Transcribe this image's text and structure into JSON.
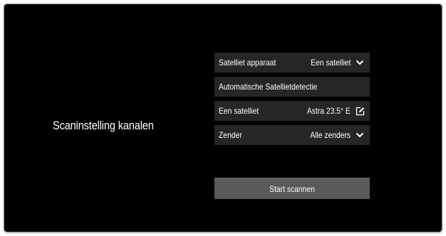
{
  "page": {
    "title": "Scaninstelling kanalen"
  },
  "settings": {
    "rows": [
      {
        "label": "Satelliet apparaat",
        "value": "Een satelliet",
        "icon": "chevron-down-icon"
      },
      {
        "label": "Automatische Satellietdetectie",
        "value": "",
        "icon": ""
      },
      {
        "label": "Een satelliet",
        "value": "Astra 23.5° E",
        "icon": "edit-icon"
      },
      {
        "label": "Zender",
        "value": "Alle zenders",
        "icon": "chevron-down-icon"
      }
    ]
  },
  "actions": {
    "start_label": "Start scannen"
  },
  "colors": {
    "background": "#000000",
    "row_background": "#262626",
    "button_background": "#5a5a5a",
    "text": "#ffffff"
  }
}
